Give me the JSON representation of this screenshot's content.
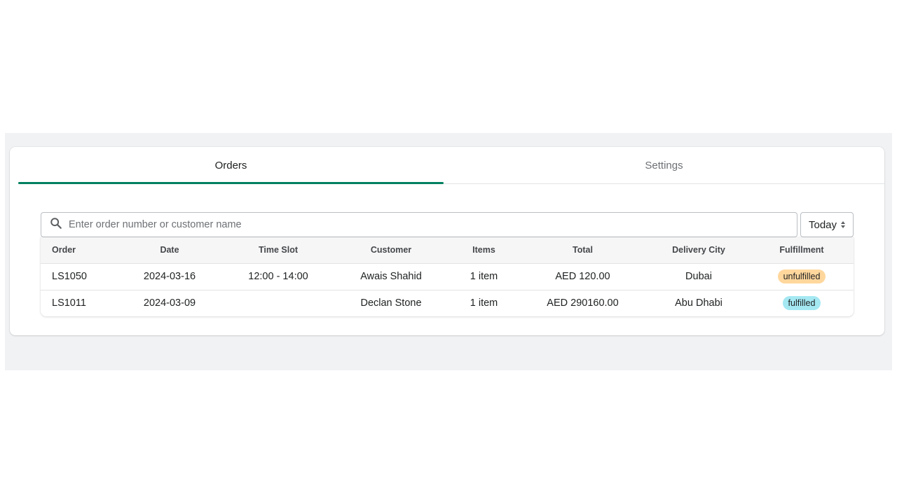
{
  "tabs": [
    {
      "label": "Orders",
      "active": true
    },
    {
      "label": "Settings",
      "active": false
    }
  ],
  "accent_color": "#008060",
  "search": {
    "placeholder": "Enter order number or customer name",
    "value": "",
    "icon": "search-icon"
  },
  "date_filter": {
    "selected": "Today",
    "icon": "select-arrows-icon"
  },
  "table": {
    "columns": [
      "Order",
      "Date",
      "Time Slot",
      "Customer",
      "Items",
      "Total",
      "Delivery City",
      "Fulfillment"
    ],
    "rows": [
      {
        "order": "LS1050",
        "date": "2024-03-16",
        "time_slot": "12:00 - 14:00",
        "customer": "Awais Shahid",
        "items": "1 item",
        "total": "AED 120.00",
        "city": "Dubai",
        "fulfillment": "unfulfilled",
        "fulfillment_color": "#ffd79d"
      },
      {
        "order": "LS1011",
        "date": "2024-03-09",
        "time_slot": "",
        "customer": "Declan Stone",
        "items": "1 item",
        "total": "AED 290160.00",
        "city": "Abu Dhabi",
        "fulfillment": "fulfilled",
        "fulfillment_color": "#a4e8f2"
      }
    ]
  }
}
